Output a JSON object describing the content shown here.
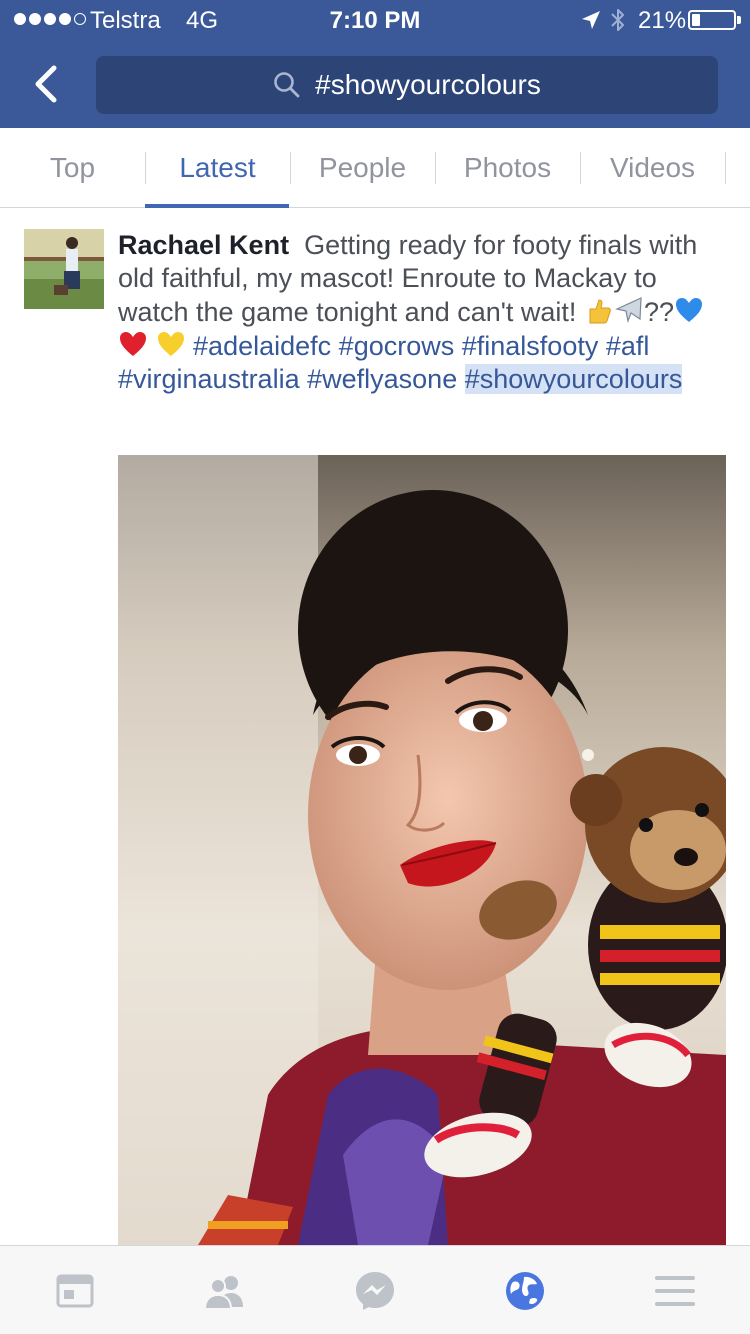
{
  "status_bar": {
    "carrier": "Telstra",
    "network": "4G",
    "time": "7:10 PM",
    "battery": "21%",
    "battery_level": 0.21,
    "signal_bars_filled": 4,
    "signal_bars_total": 5
  },
  "search": {
    "query": "#showyourcolours",
    "icon": "search-icon"
  },
  "tabs": [
    {
      "label": "Top",
      "active": false
    },
    {
      "label": "Latest",
      "active": true
    },
    {
      "label": "People",
      "active": false
    },
    {
      "label": "Photos",
      "active": false
    },
    {
      "label": "Videos",
      "active": false
    }
  ],
  "post": {
    "author": "Rachael Kent",
    "text_before_emoji": "Getting ready for footy finals with old faithful, my mascot! Enroute to Mackay to watch the game tonight and can't wait!",
    "emoji_gap": "??",
    "hashtags": [
      "#adelaidefc",
      "#gocrows",
      "#finalsfooty",
      "#afl",
      "#virginaustralia",
      "#weflyasone",
      "#showyourcolours"
    ],
    "highlighted_hashtag_index": 6
  },
  "bottom_nav": [
    {
      "icon": "news-feed-icon",
      "active": false
    },
    {
      "icon": "friends-icon",
      "active": false
    },
    {
      "icon": "messenger-icon",
      "active": false
    },
    {
      "icon": "globe-icon",
      "active": true
    },
    {
      "icon": "menu-icon",
      "active": false
    }
  ],
  "colors": {
    "brand": "#3b5998",
    "search_box": "#2c4476",
    "active": "#4267b2",
    "link": "#365899",
    "inactive_icon": "#bec2c9"
  }
}
